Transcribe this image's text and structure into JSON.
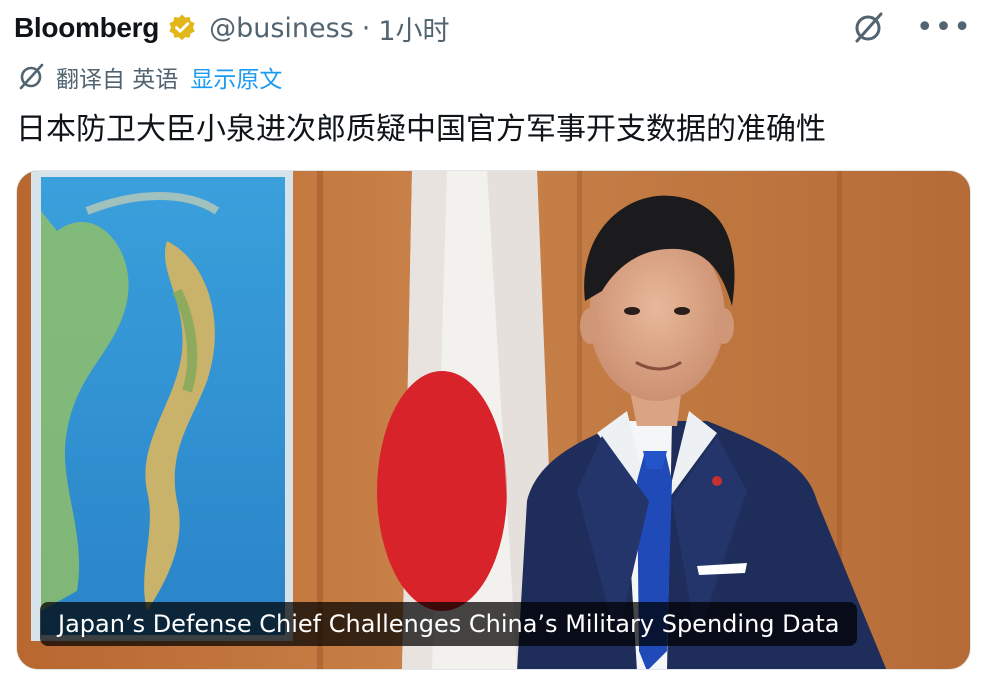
{
  "tweet": {
    "author_name": "Bloomberg",
    "handle": "@business",
    "separator": "·",
    "time": "1小时",
    "translated_from": "翻译自 英语",
    "show_original": "显示原文",
    "text": "日本防卫大臣小泉进次郎质疑中国官方军事开支数据的准确性"
  },
  "media": {
    "caption": "Japan’s Defense Chief Challenges China’s Military Spending Data"
  },
  "colors": {
    "link": "#1d9bf0",
    "verified_badge": "#e2b719",
    "text_secondary": "#536471"
  },
  "icons": [
    "verified-badge-icon",
    "grok-icon",
    "more-options-icon",
    "translate-icon"
  ]
}
